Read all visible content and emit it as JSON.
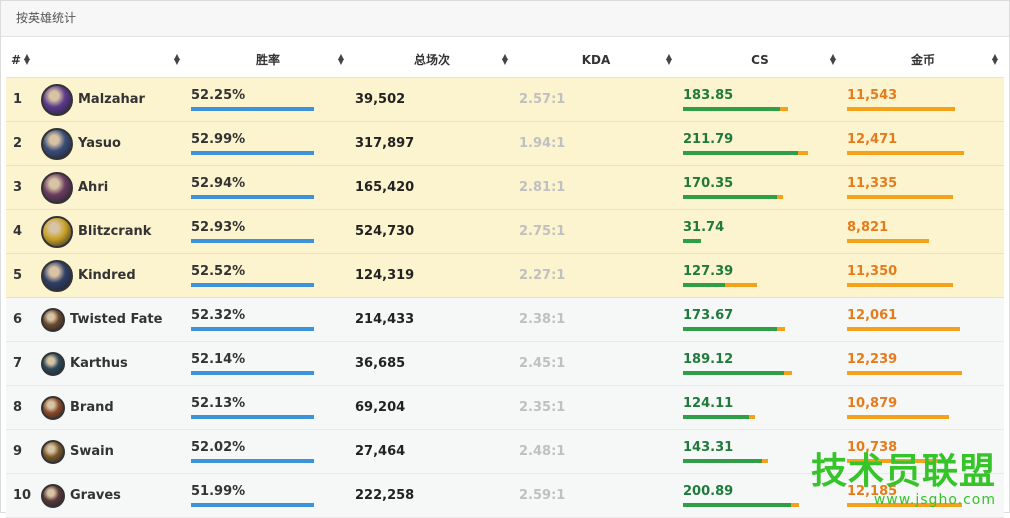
{
  "panel": {
    "title": "按英雄统计"
  },
  "headers": {
    "rank": "#",
    "champion": "",
    "win_rate": "胜率",
    "games": "总场次",
    "kda": "KDA",
    "cs": "CS",
    "gold": "金币"
  },
  "colors": {
    "win_bar": "#3d93d9",
    "cs_bar_green": "#2f9e46",
    "cs_bar_orange": "#f5a21b",
    "gold_bar": "#f5a21b",
    "top_row": "#fcf3cf"
  },
  "rows": [
    {
      "rank": "1",
      "name": "Malzahar",
      "win_rate": "52.25%",
      "games": "39,502",
      "kda": "2.57:1",
      "cs": "183.85",
      "gold": "11,543"
    },
    {
      "rank": "2",
      "name": "Yasuo",
      "win_rate": "52.99%",
      "games": "317,897",
      "kda": "1.94:1",
      "cs": "211.79",
      "gold": "12,471"
    },
    {
      "rank": "3",
      "name": "Ahri",
      "win_rate": "52.94%",
      "games": "165,420",
      "kda": "2.81:1",
      "cs": "170.35",
      "gold": "11,335"
    },
    {
      "rank": "4",
      "name": "Blitzcrank",
      "win_rate": "52.93%",
      "games": "524,730",
      "kda": "2.75:1",
      "cs": "31.74",
      "gold": "8,821"
    },
    {
      "rank": "5",
      "name": "Kindred",
      "win_rate": "52.52%",
      "games": "124,319",
      "kda": "2.27:1",
      "cs": "127.39",
      "gold": "11,350"
    },
    {
      "rank": "6",
      "name": "Twisted Fate",
      "win_rate": "52.32%",
      "games": "214,433",
      "kda": "2.38:1",
      "cs": "173.67",
      "gold": "12,061"
    },
    {
      "rank": "7",
      "name": "Karthus",
      "win_rate": "52.14%",
      "games": "36,685",
      "kda": "2.45:1",
      "cs": "189.12",
      "gold": "12,239"
    },
    {
      "rank": "8",
      "name": "Brand",
      "win_rate": "52.13%",
      "games": "69,204",
      "kda": "2.35:1",
      "cs": "124.11",
      "gold": "10,879"
    },
    {
      "rank": "9",
      "name": "Swain",
      "win_rate": "52.02%",
      "games": "27,464",
      "kda": "2.48:1",
      "cs": "143.31",
      "gold": "10,738"
    },
    {
      "rank": "10",
      "name": "Graves",
      "win_rate": "51.99%",
      "games": "222,258",
      "kda": "2.59:1",
      "cs": "200.89",
      "gold": "12,185"
    }
  ],
  "watermark": {
    "line1": "技术员联盟",
    "line2": "www.jsgho.com"
  }
}
